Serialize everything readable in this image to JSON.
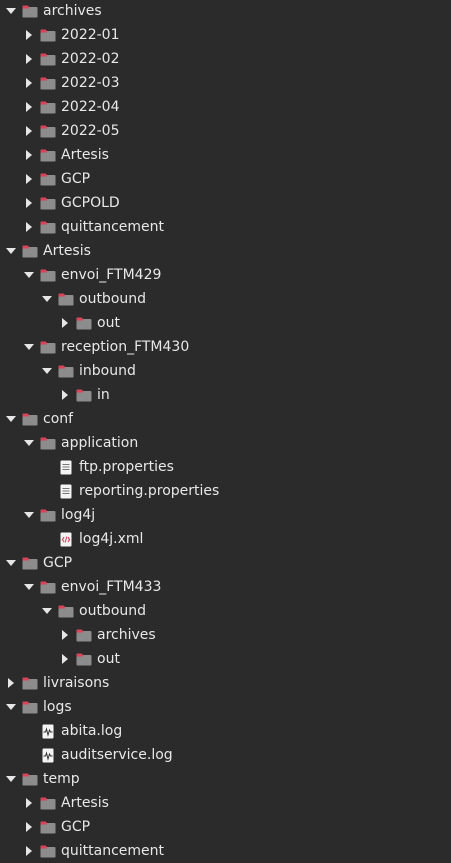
{
  "tree": {
    "rows": [
      {
        "label": "archives",
        "type": "folder",
        "expanded": true,
        "depth": 0
      },
      {
        "label": "2022-01",
        "type": "folder",
        "expanded": false,
        "depth": 1
      },
      {
        "label": "2022-02",
        "type": "folder",
        "expanded": false,
        "depth": 1
      },
      {
        "label": "2022-03",
        "type": "folder",
        "expanded": false,
        "depth": 1
      },
      {
        "label": "2022-04",
        "type": "folder",
        "expanded": false,
        "depth": 1
      },
      {
        "label": "2022-05",
        "type": "folder",
        "expanded": false,
        "depth": 1
      },
      {
        "label": "Artesis",
        "type": "folder",
        "expanded": false,
        "depth": 1
      },
      {
        "label": "GCP",
        "type": "folder",
        "expanded": false,
        "depth": 1
      },
      {
        "label": "GCPOLD",
        "type": "folder",
        "expanded": false,
        "depth": 1
      },
      {
        "label": "quittancement",
        "type": "folder",
        "expanded": false,
        "depth": 1
      },
      {
        "label": "Artesis",
        "type": "folder",
        "expanded": true,
        "depth": 0
      },
      {
        "label": "envoi_FTM429",
        "type": "folder",
        "expanded": true,
        "depth": 1
      },
      {
        "label": "outbound",
        "type": "folder",
        "expanded": true,
        "depth": 2
      },
      {
        "label": "out",
        "type": "folder",
        "expanded": false,
        "depth": 3
      },
      {
        "label": "reception_FTM430",
        "type": "folder",
        "expanded": true,
        "depth": 1
      },
      {
        "label": "inbound",
        "type": "folder",
        "expanded": true,
        "depth": 2
      },
      {
        "label": "in",
        "type": "folder",
        "expanded": false,
        "depth": 3
      },
      {
        "label": "conf",
        "type": "folder",
        "expanded": true,
        "depth": 0
      },
      {
        "label": "application",
        "type": "folder",
        "expanded": true,
        "depth": 1
      },
      {
        "label": "ftp.properties",
        "type": "file-text",
        "depth": 2
      },
      {
        "label": "reporting.properties",
        "type": "file-text",
        "depth": 2
      },
      {
        "label": "log4j",
        "type": "folder",
        "expanded": true,
        "depth": 1
      },
      {
        "label": "log4j.xml",
        "type": "file-xml",
        "depth": 2
      },
      {
        "label": "GCP",
        "type": "folder",
        "expanded": true,
        "depth": 0
      },
      {
        "label": "envoi_FTM433",
        "type": "folder",
        "expanded": true,
        "depth": 1
      },
      {
        "label": "outbound",
        "type": "folder",
        "expanded": true,
        "depth": 2
      },
      {
        "label": "archives",
        "type": "folder",
        "expanded": false,
        "depth": 3
      },
      {
        "label": "out",
        "type": "folder",
        "expanded": false,
        "depth": 3
      },
      {
        "label": "livraisons",
        "type": "folder",
        "expanded": false,
        "depth": 0
      },
      {
        "label": "logs",
        "type": "folder",
        "expanded": true,
        "depth": 0
      },
      {
        "label": "abita.log",
        "type": "file-log",
        "depth": 1
      },
      {
        "label": "auditservice.log",
        "type": "file-log",
        "depth": 1
      },
      {
        "label": "temp",
        "type": "folder",
        "expanded": true,
        "depth": 0
      },
      {
        "label": "Artesis",
        "type": "folder",
        "expanded": false,
        "depth": 1
      },
      {
        "label": "GCP",
        "type": "folder",
        "expanded": false,
        "depth": 1
      },
      {
        "label": "quittancement",
        "type": "folder",
        "expanded": false,
        "depth": 1
      }
    ]
  },
  "colors": {
    "background": "#2b2b2b",
    "text": "#e8e8e8",
    "folder_body": "#8c8c8c",
    "folder_tab": "#d6455a",
    "file_icon": "#f4f4f4",
    "xml_accent": "#d6455a"
  }
}
